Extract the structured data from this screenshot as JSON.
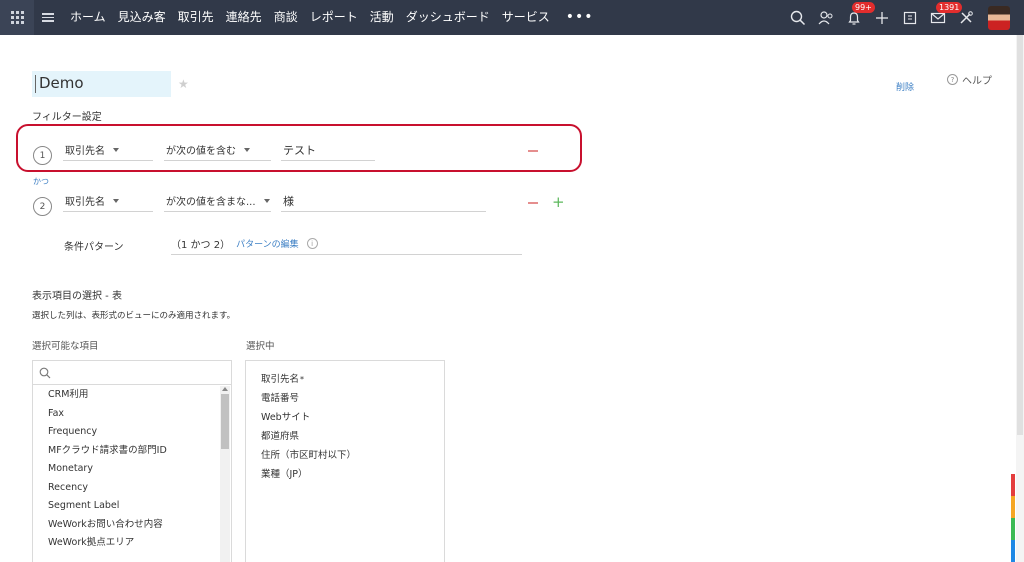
{
  "nav": {
    "items": [
      "ホーム",
      "見込み客",
      "取引先",
      "連絡先",
      "商談",
      "レポート",
      "活動",
      "ダッシュボード",
      "サービス"
    ],
    "more": "•••",
    "notification_badge": "99+",
    "mail_badge": "1391"
  },
  "header": {
    "title": "Demo",
    "delete_label": "削除",
    "help_label": "ヘルプ"
  },
  "filter": {
    "section_label": "フィルター設定",
    "rows": [
      {
        "num": "1",
        "field": "取引先名",
        "operator": "が次の値を含む",
        "value": "テスト"
      },
      {
        "num": "2",
        "field": "取引先名",
        "operator": "が次の値を含まな...",
        "value": "様"
      }
    ],
    "and_label": "かつ",
    "pattern_label": "条件パターン",
    "pattern_value": "（1 かつ 2）",
    "pattern_edit": "パターンの編集"
  },
  "columns": {
    "section_label": "表示項目の選択 - 表",
    "note": "選択した列は、表形式のビューにのみ適用されます。",
    "available_label": "選択可能な項目",
    "selected_label": "選択中",
    "available_items": [
      "CRM利用",
      "Fax",
      "Frequency",
      "MFクラウド請求書の部門ID",
      "Monetary",
      "Recency",
      "Segment Label",
      "WeWorkお問い合わせ内容",
      "WeWork拠点エリア"
    ],
    "selected_items": [
      {
        "label": "取引先名",
        "required": "*"
      },
      {
        "label": "電話番号"
      },
      {
        "label": "Webサイト"
      },
      {
        "label": "都道府県"
      },
      {
        "label": "住所（市区町村以下）"
      },
      {
        "label": "業種（JP）"
      }
    ]
  }
}
